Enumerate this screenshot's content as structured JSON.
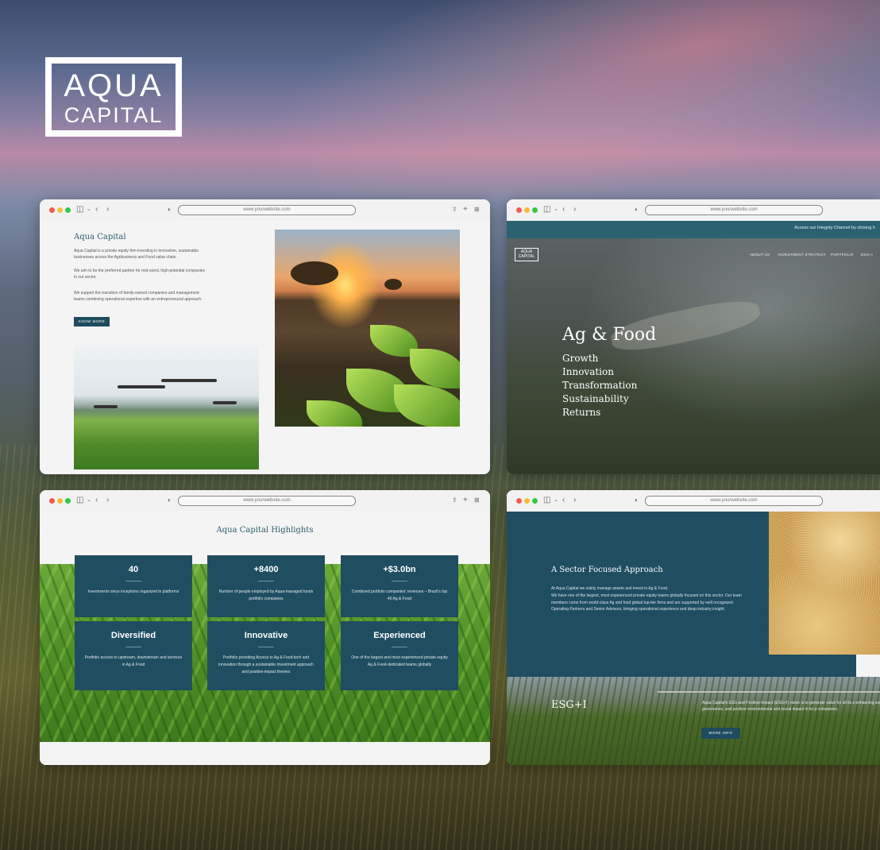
{
  "brand": {
    "logo_line1": "AQUA",
    "logo_line2": "CAPITAL"
  },
  "browser": {
    "url": "www.yourwebsite.com"
  },
  "window1": {
    "title": "Aqua Capital",
    "paragraph1": "Aqua Capital is a private equity firm investing in innovative, sustainable businesses across the Agribusiness and Food value chain.",
    "paragraph2": "We aim to be the preferred partner for mid-sized, high-potential companies in our sector.",
    "paragraph3": "We support the transition of family-owned companies and management teams combining operational expertise with an entrepreneurial approach.",
    "button": "KNOW MORE"
  },
  "window2": {
    "top_bar": "Access our Integrity Channel by clicking h",
    "logo_line1": "AQUA",
    "logo_line2": "CAPITAL",
    "nav": [
      "ABOUT US",
      "INVESTMENT STRATEGY",
      "PORTFOLIO",
      "ESG+I"
    ],
    "headline": "Ag & Food",
    "items": [
      "Growth",
      "Innovation",
      "Transformation",
      "Sustainability",
      "Returns"
    ]
  },
  "window3": {
    "title": "Aqua Capital Highlights",
    "cards": [
      {
        "big": "40",
        "desc": "Investments since inceptions organized in platforms"
      },
      {
        "big": "+8400",
        "desc": "Number of people employed by Aqua-managed funds portfolio companies"
      },
      {
        "big": "+$3.0bn",
        "desc": "Combined portfolio companies' revenues – Brazil's top 40 Ag & Food"
      },
      {
        "big": "Diversified",
        "desc": "Portfolio access to upstream, downstream and services in Ag & Food"
      },
      {
        "big": "Innovative",
        "desc": "Portfolio providing Access to Ag & Food tech and innovation through a sustainable investment approach and positive-impact themes"
      },
      {
        "big": "Experienced",
        "desc": "One of the largest and most experienced private equity Ag & Food-dedicated teams globally"
      }
    ]
  },
  "window4": {
    "title": "A Sector Focused Approach",
    "paragraph1": "At Aqua Capital we solely manage assets and invest in Ag & Food.",
    "paragraph2": "We have one of the largest, most experienced private equity teams globally focused on this sector. Our team members come from world-class Ag and food global top-tier firms and are supported by well recognized Operating Partners and Senior Advisors, bringing operational experience and deep industry insight.",
    "esg_title": "ESG+I",
    "esg_text": "Aqua Capital's ESG and Positive-Impact (ESG+I) vision is to generate value for all its s enhancing sound governance, and positive environmental and social impact in its p companies.",
    "button": "MORE INFO"
  }
}
